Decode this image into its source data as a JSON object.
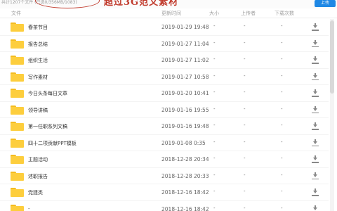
{
  "top": {
    "caption": "共计1207个文件 (已选0/356MB/1083)",
    "banner": "超过3G范文素材",
    "upload_label": "上传"
  },
  "columns": {
    "file": "文件",
    "time": "更新时间",
    "size": "大小",
    "uploader": "上传者",
    "downloads": "下载次数"
  },
  "rows": [
    {
      "name": "春茶节目",
      "time": "2019-01-29 19:48",
      "size": "-",
      "uploader": "-",
      "downloads": "-"
    },
    {
      "name": "报告总结",
      "time": "2019-01-27 11:04",
      "size": "-",
      "uploader": "-",
      "downloads": "-"
    },
    {
      "name": "组织生活",
      "time": "2019-01-27 11:02",
      "size": "-",
      "uploader": "-",
      "downloads": "-"
    },
    {
      "name": "写作素材",
      "time": "2019-01-27 10:58",
      "size": "-",
      "uploader": "-",
      "downloads": "-"
    },
    {
      "name": "今日头条每日文章",
      "time": "2019-01-20 10:41",
      "size": "-",
      "uploader": "-",
      "downloads": "-"
    },
    {
      "name": "领导讲稿",
      "time": "2019-01-16 19:55",
      "size": "-",
      "uploader": "-",
      "downloads": "-"
    },
    {
      "name": "第一任职系列文稿",
      "time": "2019-01-16 19:48",
      "size": "-",
      "uploader": "-",
      "downloads": "-"
    },
    {
      "name": "四十二项贡献PPT模板",
      "time": "2019-01-08 0:35",
      "size": "-",
      "uploader": "-",
      "downloads": "-"
    },
    {
      "name": "主题活动",
      "time": "2018-12-28 20:34",
      "size": "-",
      "uploader": "-",
      "downloads": "-"
    },
    {
      "name": "述职报告",
      "time": "2018-12-28 20:33",
      "size": "-",
      "uploader": "-",
      "downloads": "-"
    },
    {
      "name": "党建类",
      "time": "2018-12-16 18:42",
      "size": "-",
      "uploader": "-",
      "downloads": "-"
    },
    {
      "name": "-",
      "time": "2018-12-16 18:42",
      "size": "-",
      "uploader": "-",
      "downloads": "-"
    }
  ],
  "colors": {
    "folder": "#fdce3d",
    "banner": "#c0392b",
    "upload_button": "#1e88e5"
  },
  "icons": {
    "row": "folder-icon",
    "action": "download-icon"
  }
}
